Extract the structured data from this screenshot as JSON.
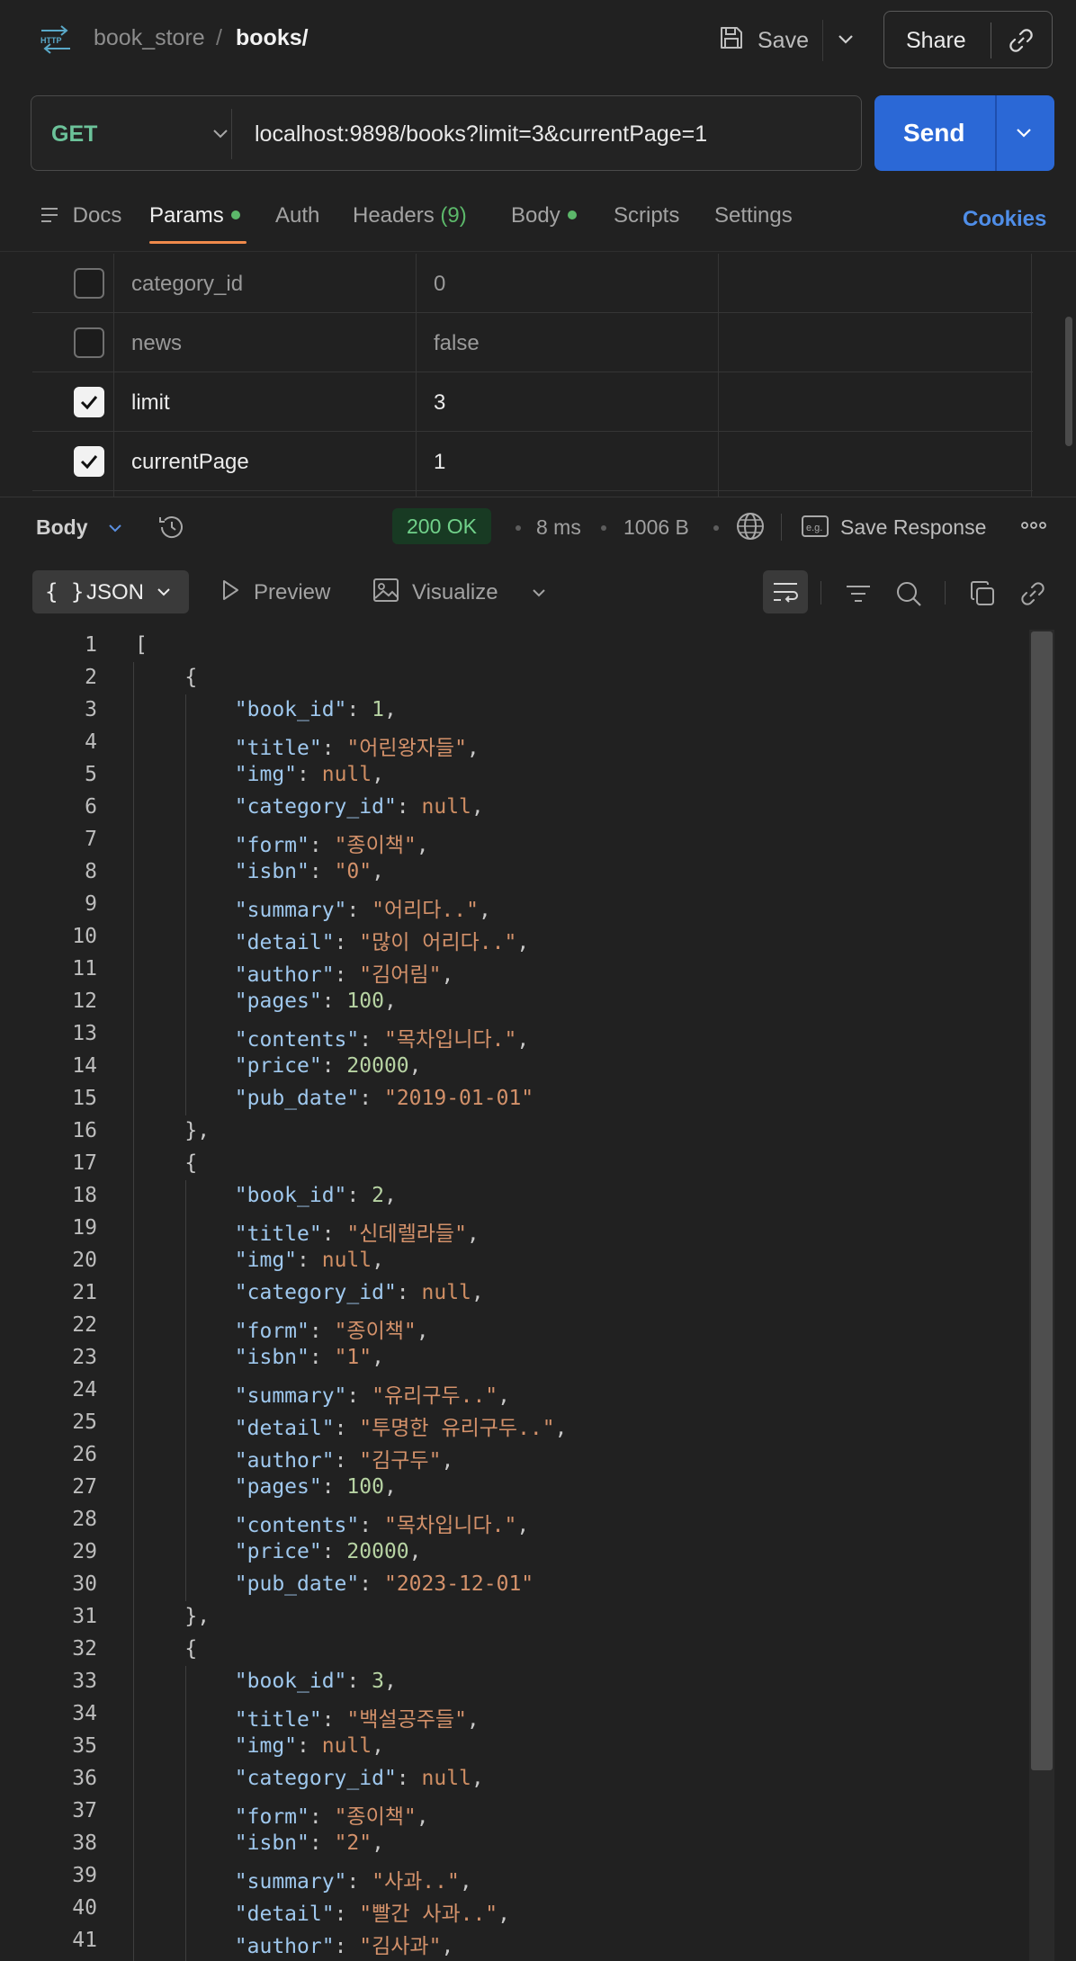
{
  "header": {
    "collection": "book_store",
    "separator": "/",
    "request_name": "books/",
    "save_label": "Save",
    "share_label": "Share"
  },
  "request": {
    "method": "GET",
    "url": "localhost:9898/books?limit=3&currentPage=1",
    "send_label": "Send"
  },
  "tabs": {
    "docs": "Docs",
    "params": "Params",
    "auth": "Auth",
    "headers": "Headers",
    "headers_count": "(9)",
    "body": "Body",
    "scripts": "Scripts",
    "settings": "Settings",
    "cookies": "Cookies"
  },
  "params": [
    {
      "key": "category_id",
      "value": "0",
      "checked": false
    },
    {
      "key": "news",
      "value": "false",
      "checked": false
    },
    {
      "key": "limit",
      "value": "3",
      "checked": true
    },
    {
      "key": "currentPage",
      "value": "1",
      "checked": true
    }
  ],
  "response": {
    "body_label": "Body",
    "status": "200 OK",
    "time": "8 ms",
    "size": "1006 B",
    "save_response": "Save Response"
  },
  "viewer": {
    "json_label": "JSON",
    "json_brace": "{ }",
    "preview_label": "Preview",
    "visualize_label": "Visualize"
  },
  "code_lines": [
    {
      "n": "1",
      "t": "["
    },
    {
      "n": "2",
      "t": "    {"
    },
    {
      "n": "3",
      "t": "        \"book_id\": 1,"
    },
    {
      "n": "4",
      "t": "        \"title\": \"어린왕자들\","
    },
    {
      "n": "5",
      "t": "        \"img\": null,"
    },
    {
      "n": "6",
      "t": "        \"category_id\": null,"
    },
    {
      "n": "7",
      "t": "        \"form\": \"종이책\","
    },
    {
      "n": "8",
      "t": "        \"isbn\": \"0\","
    },
    {
      "n": "9",
      "t": "        \"summary\": \"어리다..\","
    },
    {
      "n": "10",
      "t": "        \"detail\": \"많이 어리다..\","
    },
    {
      "n": "11",
      "t": "        \"author\": \"김어림\","
    },
    {
      "n": "12",
      "t": "        \"pages\": 100,"
    },
    {
      "n": "13",
      "t": "        \"contents\": \"목차입니다.\","
    },
    {
      "n": "14",
      "t": "        \"price\": 20000,"
    },
    {
      "n": "15",
      "t": "        \"pub_date\": \"2019-01-01\""
    },
    {
      "n": "16",
      "t": "    },"
    },
    {
      "n": "17",
      "t": "    {"
    },
    {
      "n": "18",
      "t": "        \"book_id\": 2,"
    },
    {
      "n": "19",
      "t": "        \"title\": \"신데렐라들\","
    },
    {
      "n": "20",
      "t": "        \"img\": null,"
    },
    {
      "n": "21",
      "t": "        \"category_id\": null,"
    },
    {
      "n": "22",
      "t": "        \"form\": \"종이책\","
    },
    {
      "n": "23",
      "t": "        \"isbn\": \"1\","
    },
    {
      "n": "24",
      "t": "        \"summary\": \"유리구두..\","
    },
    {
      "n": "25",
      "t": "        \"detail\": \"투명한 유리구두..\","
    },
    {
      "n": "26",
      "t": "        \"author\": \"김구두\","
    },
    {
      "n": "27",
      "t": "        \"pages\": 100,"
    },
    {
      "n": "28",
      "t": "        \"contents\": \"목차입니다.\","
    },
    {
      "n": "29",
      "t": "        \"price\": 20000,"
    },
    {
      "n": "30",
      "t": "        \"pub_date\": \"2023-12-01\""
    },
    {
      "n": "31",
      "t": "    },"
    },
    {
      "n": "32",
      "t": "    {"
    },
    {
      "n": "33",
      "t": "        \"book_id\": 3,"
    },
    {
      "n": "34",
      "t": "        \"title\": \"백설공주들\","
    },
    {
      "n": "35",
      "t": "        \"img\": null,"
    },
    {
      "n": "36",
      "t": "        \"category_id\": null,"
    },
    {
      "n": "37",
      "t": "        \"form\": \"종이책\","
    },
    {
      "n": "38",
      "t": "        \"isbn\": \"2\","
    },
    {
      "n": "39",
      "t": "        \"summary\": \"사과..\","
    },
    {
      "n": "40",
      "t": "        \"detail\": \"빨간 사과..\","
    },
    {
      "n": "41",
      "t": "        \"author\": \"김사과\","
    }
  ],
  "colors": {
    "accent_tab": "#f08a4b",
    "send": "#2b68d6",
    "method": "#6cc29a",
    "status_ok": "#71d18a",
    "json_key": "#9fc8ee",
    "json_string": "#d3916a",
    "json_number": "#b7d3a3"
  }
}
